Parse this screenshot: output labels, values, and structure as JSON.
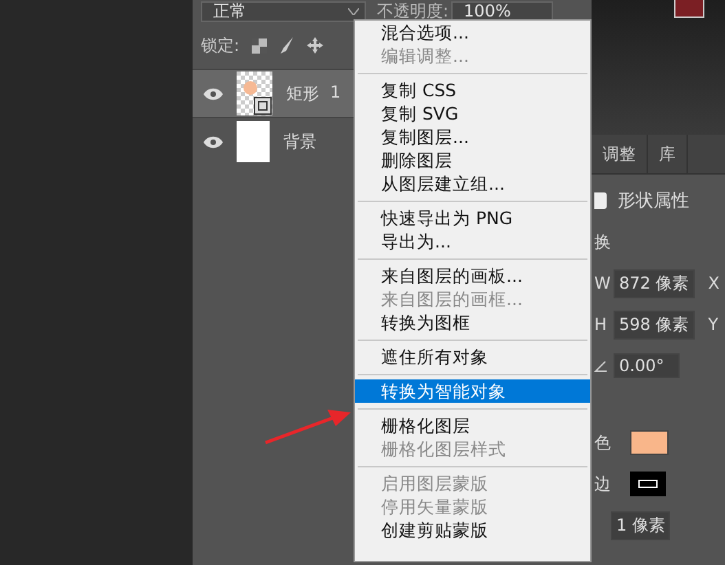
{
  "layers_panel": {
    "blend_mode": "正常",
    "opacity_label": "不透明度:",
    "opacity_value": "100%",
    "lock_label": "锁定:",
    "layers": [
      {
        "name": "矩形",
        "badge": "1",
        "kind": "shape",
        "selected": true,
        "visible": true
      },
      {
        "name": "背景",
        "kind": "fill",
        "selected": false,
        "visible": true
      }
    ]
  },
  "properties_panel": {
    "tabs": [
      {
        "label": "调整",
        "selected": false
      },
      {
        "label": "库",
        "selected": false
      }
    ],
    "title": "形状属性",
    "section_label": "换",
    "w_label": "W",
    "w_value": "872 像素",
    "x_label": "X",
    "h_label": "H",
    "h_value": "598 像素",
    "y_label": "Y",
    "angle_value": "0.00°",
    "fill": {
      "label": "色",
      "color": "#f9b68a"
    },
    "stroke": {
      "label": "边",
      "width": "1 像素"
    }
  },
  "context_menu": {
    "groups": [
      [
        {
          "label": "混合选项...",
          "disabled": false,
          "selected": false
        },
        {
          "label": "编辑调整...",
          "disabled": true,
          "selected": false
        }
      ],
      [
        {
          "label": "复制 CSS",
          "disabled": false,
          "selected": false
        },
        {
          "label": "复制 SVG",
          "disabled": false,
          "selected": false
        },
        {
          "label": "复制图层...",
          "disabled": false,
          "selected": false
        },
        {
          "label": "删除图层",
          "disabled": false,
          "selected": false
        },
        {
          "label": "从图层建立组...",
          "disabled": false,
          "selected": false
        }
      ],
      [
        {
          "label": "快速导出为 PNG",
          "disabled": false,
          "selected": false
        },
        {
          "label": "导出为...",
          "disabled": false,
          "selected": false
        }
      ],
      [
        {
          "label": "来自图层的画板...",
          "disabled": false,
          "selected": false
        },
        {
          "label": "来自图层的画框...",
          "disabled": true,
          "selected": false
        },
        {
          "label": "转换为图框",
          "disabled": false,
          "selected": false
        }
      ],
      [
        {
          "label": "遮住所有对象",
          "disabled": false,
          "selected": false
        }
      ],
      [
        {
          "label": "转换为智能对象",
          "disabled": false,
          "selected": true
        }
      ],
      [
        {
          "label": "栅格化图层",
          "disabled": false,
          "selected": false
        },
        {
          "label": "栅格化图层样式",
          "disabled": true,
          "selected": false
        }
      ],
      [
        {
          "label": "启用图层蒙版",
          "disabled": true,
          "selected": false
        },
        {
          "label": "停用矢量蒙版",
          "disabled": true,
          "selected": false
        },
        {
          "label": "创建剪贴蒙版",
          "disabled": false,
          "selected": false
        }
      ]
    ]
  }
}
